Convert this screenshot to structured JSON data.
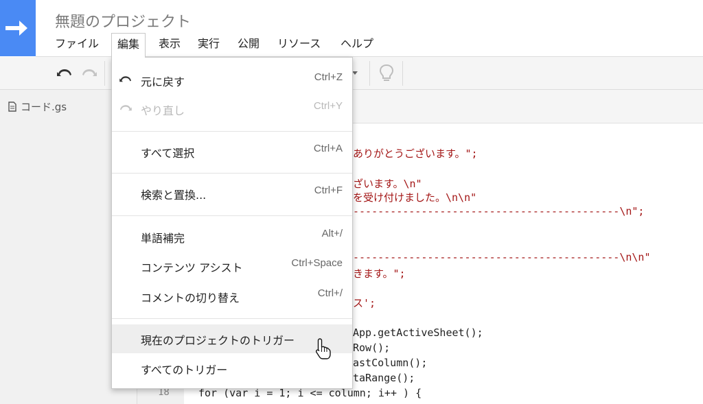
{
  "app": {
    "title": "無題のプロジェクト",
    "logo_icon": "arrow-right-icon",
    "accent_color": "#4a8af4"
  },
  "menubar": {
    "items": [
      {
        "label": "ファイル"
      },
      {
        "label": "編集"
      },
      {
        "label": "表示"
      },
      {
        "label": "実行"
      },
      {
        "label": "公開"
      },
      {
        "label": "リソース"
      },
      {
        "label": "ヘルプ"
      }
    ],
    "active": "編集"
  },
  "toolbar": {
    "buttons": [
      "undo-icon",
      "redo-icon",
      "dropdown-arrow-icon",
      "lightbulb-icon"
    ]
  },
  "sidebar": {
    "file": {
      "icon": "document-icon",
      "name": "コード.gs"
    }
  },
  "edit_menu": {
    "groups": [
      [
        {
          "label": "元に戻す",
          "shortcut": "Ctrl+Z",
          "icon": "undo-icon",
          "enabled": true
        },
        {
          "label": "やり直し",
          "shortcut": "Ctrl+Y",
          "icon": "redo-icon",
          "enabled": false
        }
      ],
      [
        {
          "label": "すべて選択",
          "shortcut": "Ctrl+A",
          "enabled": true
        }
      ],
      [
        {
          "label": "検索と置換...",
          "shortcut": "Ctrl+F",
          "enabled": true
        }
      ],
      [
        {
          "label": "単語補完",
          "shortcut": "Alt+/",
          "enabled": true
        },
        {
          "label": "コンテンツ アシスト",
          "shortcut": "Ctrl+Space",
          "enabled": true
        },
        {
          "label": "コメントの切り替え",
          "shortcut": "Ctrl+/",
          "enabled": true
        }
      ],
      [
        {
          "label": "現在のプロジェクトのトリガー",
          "shortcut": "",
          "enabled": true,
          "hovered": true
        },
        {
          "label": "すべてのトリガー",
          "shortcut": "",
          "enabled": true
        }
      ]
    ]
  },
  "code": {
    "visible_fragments": [
      "ありがとうございます。\";",
      "ざいます。\\n\"",
      "を受け付けました。\\n\\n\"",
      "-------------------------------------------\\n\";",
      "-------------------------------------------\\n\\n\"",
      "きます。\";",
      "ス';",
      "App.getActiveSheet();",
      "Row();",
      "astColumn();",
      "taRange();",
      "for (var i = 1; i <= column; i++ ) {"
    ],
    "line_number": "18"
  }
}
